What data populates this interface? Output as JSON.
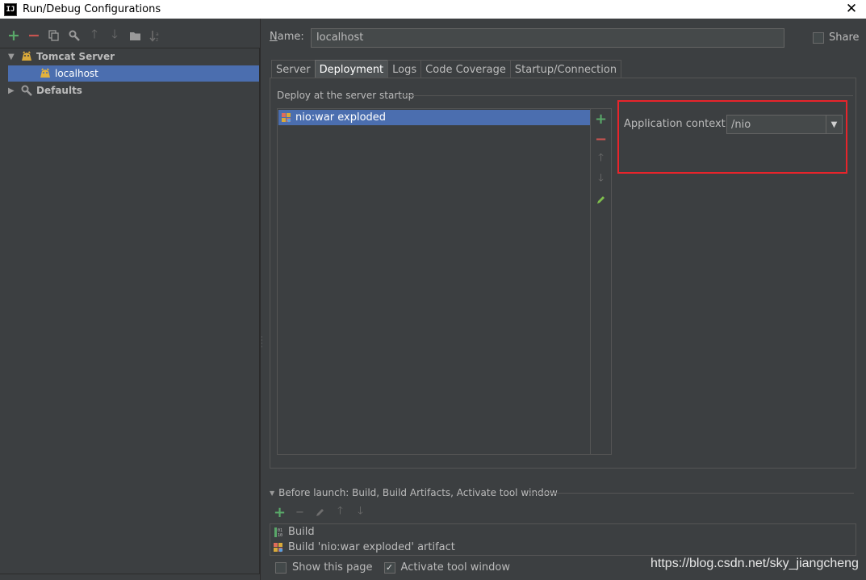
{
  "window": {
    "title": "Run/Debug Configurations",
    "app_icon": "IJ",
    "close_icon": "✕"
  },
  "left_toolbar": {
    "icons": [
      "add-icon",
      "remove-icon",
      "copy-icon",
      "wrench-icon",
      "arrow-up-icon",
      "arrow-down-icon",
      "folder-icon",
      "sort-icon"
    ]
  },
  "tree": {
    "items": [
      {
        "label": "Tomcat Server",
        "expanded": true,
        "bold": true
      },
      {
        "label": "localhost",
        "selected": true
      },
      {
        "label": "Defaults",
        "expanded": false,
        "bold": true
      }
    ]
  },
  "form": {
    "name_label": "Name:",
    "name_value": "localhost",
    "share_label": "Share",
    "share_checked": false
  },
  "tabs": [
    {
      "label": "Server",
      "active": false
    },
    {
      "label": "Deployment",
      "active": true
    },
    {
      "label": "Logs",
      "active": false
    },
    {
      "label": "Code Coverage",
      "active": false
    },
    {
      "label": "Startup/Connection",
      "active": false
    }
  ],
  "deployment": {
    "section_title": "Deploy at the server startup",
    "artifacts": [
      {
        "label": "nio:war exploded",
        "selected": true
      }
    ],
    "app_context_label": "Application context:",
    "app_context_value": "/nio",
    "highlight_color": "#e8242b"
  },
  "before_launch": {
    "header": "Before launch: Build, Build Artifacts, Activate tool window",
    "items": [
      {
        "label": "Build",
        "icon": "binary-icon"
      },
      {
        "label": "Build 'nio:war exploded' artifact",
        "icon": "war-icon"
      }
    ]
  },
  "bottom": {
    "show_page_label": "Show this page",
    "show_page_checked": false,
    "activate_label": "Activate tool window",
    "activate_checked": true
  },
  "watermark": "https://blog.csdn.net/sky_jiangcheng",
  "colors": {
    "background": "#3c3f41",
    "selection": "#4b6eaf",
    "add": "#59a869",
    "remove": "#c75450"
  }
}
